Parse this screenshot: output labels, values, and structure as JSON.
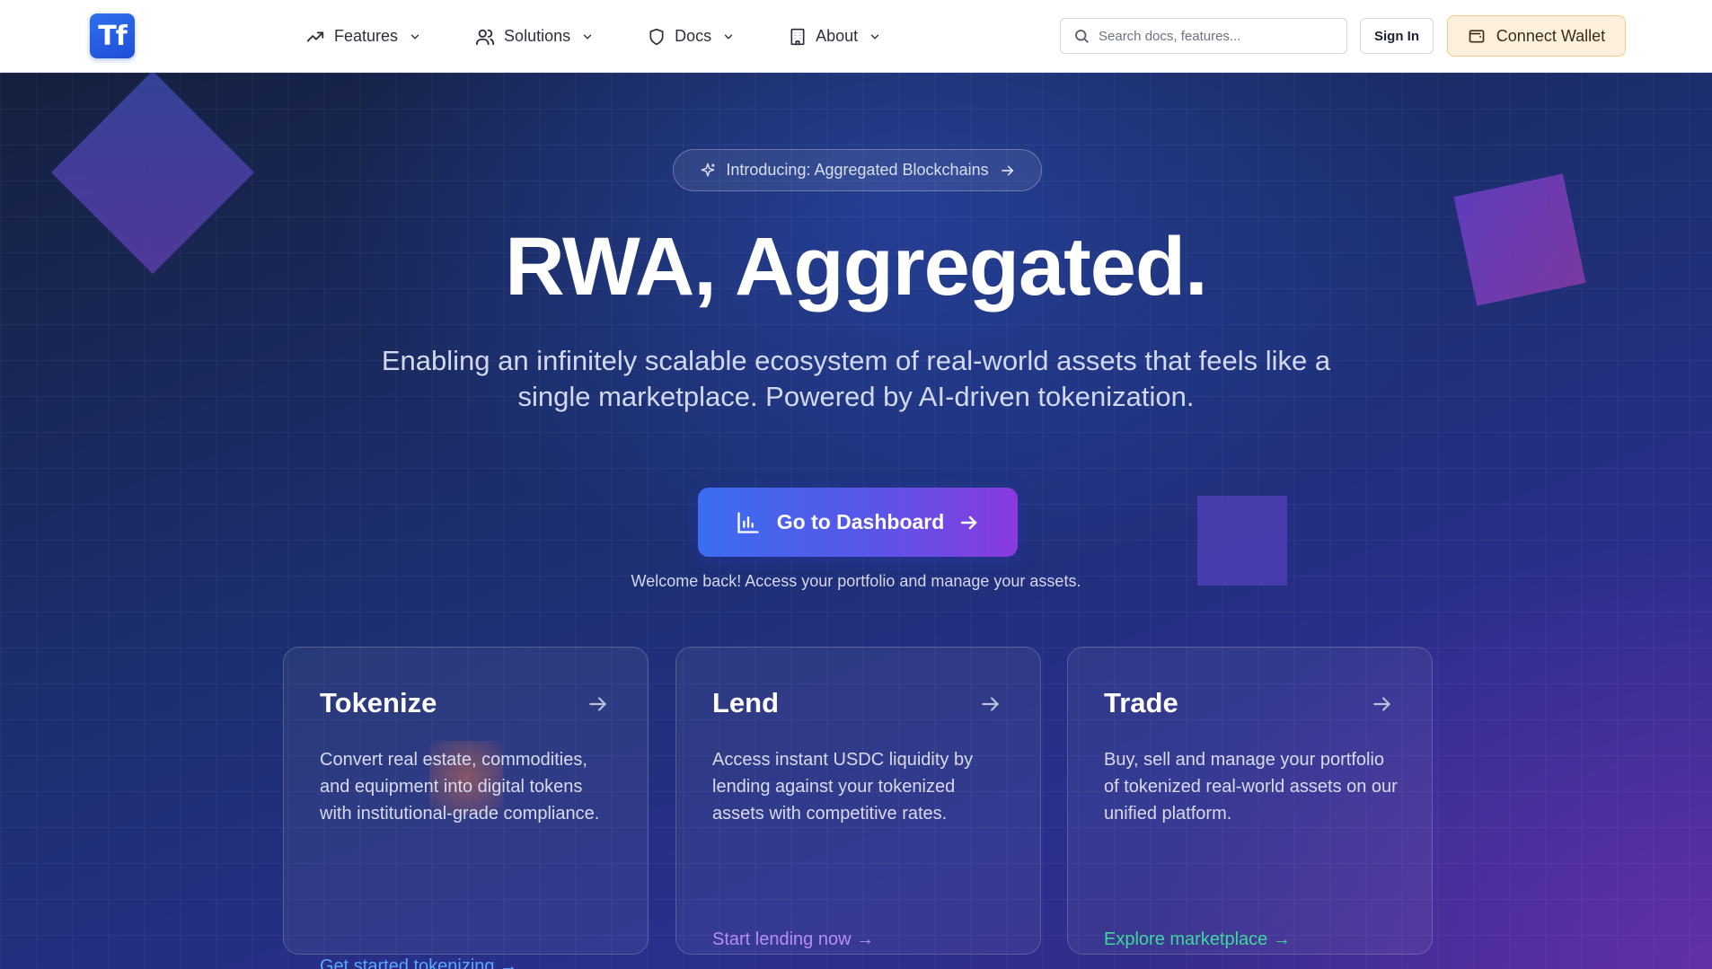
{
  "header": {
    "logo_text": "Tf",
    "nav": [
      {
        "label": "Features",
        "icon": "trending-up-icon"
      },
      {
        "label": "Solutions",
        "icon": "users-icon"
      },
      {
        "label": "Docs",
        "icon": "shield-icon"
      },
      {
        "label": "About",
        "icon": "building-icon"
      }
    ],
    "search_placeholder": "Search docs, features...",
    "sign_in": "Sign In",
    "connect_wallet": "Connect Wallet"
  },
  "hero": {
    "announcement": "Introducing: Aggregated Blockchains",
    "title": "RWA, Aggregated.",
    "subtitle": "Enabling an infinitely scalable ecosystem of real-world assets that feels like a single marketplace. Powered by AI-driven tokenization.",
    "cta_label": "Go to Dashboard",
    "welcome": "Welcome back! Access your portfolio and manage your assets."
  },
  "cards": [
    {
      "title": "Tokenize",
      "description": "Convert real estate, commodities, and equipment into digital tokens with institutional-grade compliance.",
      "link": "Get started tokenizing →",
      "link_color": "#5aa6ff"
    },
    {
      "title": "Lend",
      "description": "Access instant USDC liquidity by lending against your tokenized assets with competitive rates.",
      "link": "Start lending now →",
      "link_color": "#b98cf5"
    },
    {
      "title": "Trade",
      "description": "Buy, sell and manage your portfolio of tokenized real-world assets on our unified platform.",
      "link": "Explore marketplace →",
      "link_color": "#3fd6a0"
    }
  ],
  "colors": {
    "brand_blue": "#2f6ff0",
    "wallet_bg": "#fdf0dc",
    "hero_bg": "#1d2f72"
  }
}
